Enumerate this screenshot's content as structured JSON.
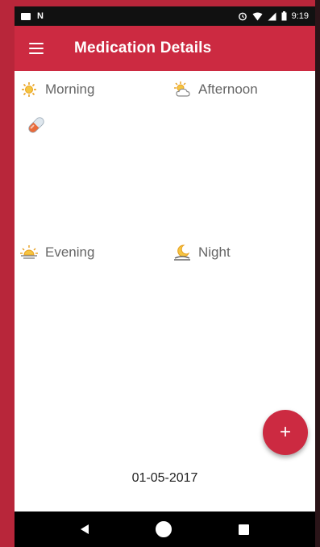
{
  "status_bar": {
    "time": "9:19",
    "icons": [
      "image-icon",
      "n-icon",
      "alarm-icon",
      "wifi-icon",
      "signal-icon",
      "battery-icon"
    ]
  },
  "app_bar": {
    "title": "Medication Details",
    "menu_icon": "hamburger-menu-icon"
  },
  "sections": {
    "morning": {
      "label": "Morning",
      "icon": "sun-icon"
    },
    "afternoon": {
      "label": "Afternoon",
      "icon": "sun-cloud-icon"
    },
    "evening": {
      "label": "Evening",
      "icon": "sunset-icon"
    },
    "night": {
      "label": "Night",
      "icon": "moon-icon"
    }
  },
  "morning_items": [
    {
      "icon": "pill-capsule-icon"
    }
  ],
  "fab": {
    "label": "+",
    "icon": "add-icon"
  },
  "date": "01-05-2017",
  "nav_bar": {
    "icons": [
      "back-icon",
      "home-icon",
      "recents-icon"
    ]
  },
  "colors": {
    "primary": "#cc2a41",
    "background_frame": "#b8263a",
    "nav_bar": "#000000",
    "status_bar": "#111111"
  }
}
